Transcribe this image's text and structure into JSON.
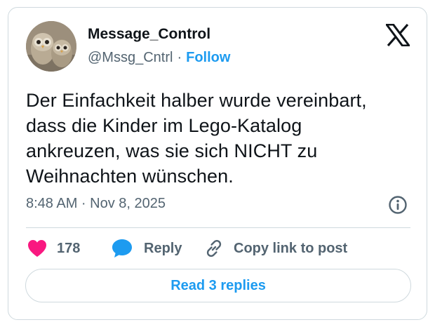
{
  "author": {
    "name": "Message_Control",
    "handle": "@Mssg_Cntrl",
    "separator": "·",
    "follow_label": "Follow"
  },
  "tweet": {
    "text": "Der Einfachkeit halber wurde vereinbart,\ndass die Kinder im Lego-Katalog\nankreuzen, was sie sich NICHT zu\nWeihnachten wünschen.",
    "timestamp": "8:48 AM · Nov 8, 2025"
  },
  "actions": {
    "like_count": "178",
    "reply_label": "Reply",
    "copy_label": "Copy link to post"
  },
  "read_replies_label": "Read 3 replies",
  "icons": {
    "logo": "x-logo-icon",
    "info": "info-icon",
    "like": "heart-icon",
    "reply": "speech-bubble-icon",
    "copy": "link-icon"
  },
  "colors": {
    "accent": "#1d9bf0",
    "like": "#f91880",
    "text_primary": "#0f1419",
    "text_secondary": "#536471",
    "border": "#cfd9de"
  }
}
